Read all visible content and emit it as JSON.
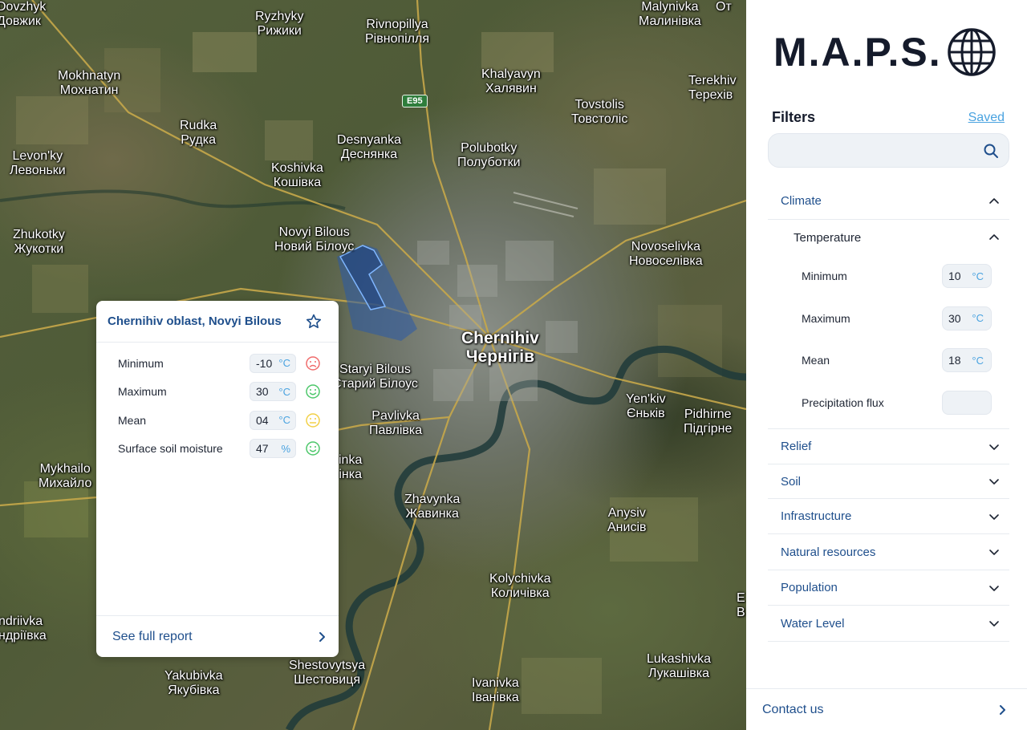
{
  "map": {
    "road_shield": "E95",
    "places": [
      {
        "id": "dovzhyk",
        "latin": "Dovzhyk",
        "cyr": "Довжик"
      },
      {
        "id": "ryzhyky",
        "latin": "Ryzhyky",
        "cyr": "Рижики"
      },
      {
        "id": "rivnopillya",
        "latin": "Rivnopillya",
        "cyr": "Рівнопілля"
      },
      {
        "id": "malynivka",
        "latin": "Malynivka",
        "cyr": "Малинівка"
      },
      {
        "id": "mokhnatyn",
        "latin": "Mokhnatyn",
        "cyr": "Мохнатин"
      },
      {
        "id": "khalyavyn",
        "latin": "Khalyavyn",
        "cyr": "Халявин"
      },
      {
        "id": "terekhivka",
        "latin": "Terekhiv",
        "cyr": "Терехів"
      },
      {
        "id": "tovstolis",
        "latin": "Tovstolis",
        "cyr": "Товстоліс"
      },
      {
        "id": "rudka",
        "latin": "Rudka",
        "cyr": "Рудка"
      },
      {
        "id": "desnyanka",
        "latin": "Desnyanka",
        "cyr": "Деснянка"
      },
      {
        "id": "polubotky",
        "latin": "Polubotky",
        "cyr": "Полуботки"
      },
      {
        "id": "levonky",
        "latin": "Levon'ky",
        "cyr": "Левоньки"
      },
      {
        "id": "koshivka",
        "latin": "Koshivka",
        "cyr": "Кошівка"
      },
      {
        "id": "zhukotky",
        "latin": "Zhukotky",
        "cyr": "Жукотки"
      },
      {
        "id": "novyi-bilous",
        "latin": "Novyi Bilous",
        "cyr": "Новий Білоус"
      },
      {
        "id": "novoselivka",
        "latin": "Novoselivka",
        "cyr": "Новоселівка"
      },
      {
        "id": "chernihiv",
        "latin": "Chernihiv",
        "cyr": "Чернігів"
      },
      {
        "id": "staryi-bilous",
        "latin": "Staryi Bilous",
        "cyr": "Старий Білоус"
      },
      {
        "id": "yenkiv",
        "latin": "Yen'kiv",
        "cyr": "Єньків"
      },
      {
        "id": "pidhirne",
        "latin": "Pidhirne",
        "cyr": "Підгірне"
      },
      {
        "id": "pavlivka",
        "latin": "Pavlivka",
        "cyr": "Павлівка"
      },
      {
        "id": "mykhailo",
        "latin": "Mykhailo",
        "cyr": "Михайло"
      },
      {
        "id": "inka",
        "latin": "inka",
        "cyr": "інка"
      },
      {
        "id": "zhavynka",
        "latin": "Zhavynka",
        "cyr": "Жавинка"
      },
      {
        "id": "anysiv",
        "latin": "Anysiv",
        "cyr": "Анисів"
      },
      {
        "id": "andriivka",
        "latin": "ndriivka",
        "cyr": "ндріївка"
      },
      {
        "id": "kolychivka",
        "latin": "Kolychivka",
        "cyr": "Количівка"
      },
      {
        "id": "yakubivka",
        "latin": "Yakubivka",
        "cyr": "Якубівка"
      },
      {
        "id": "shestovytsya",
        "latin": "Shestovytsya",
        "cyr": "Шестовиця"
      },
      {
        "id": "ivanivka",
        "latin": "Ivanivka",
        "cyr": "Іванівка"
      },
      {
        "id": "lukashivka",
        "latin": "Lukashivka",
        "cyr": "Лукашівка"
      },
      {
        "id": "ot",
        "latin": "",
        "cyr": "От"
      },
      {
        "id": "edge-e",
        "latin": "",
        "cyr": "Е"
      },
      {
        "id": "edge-b",
        "latin": "",
        "cyr": "В"
      }
    ]
  },
  "card": {
    "title": "Chernihiv oblast, Novyi Bilous",
    "rows": [
      {
        "label": "Minimum",
        "value": "-10",
        "unit": "°C",
        "mood": "sad",
        "mood_color": "#f06b6b"
      },
      {
        "label": "Maximum",
        "value": "30",
        "unit": "°C",
        "mood": "happy",
        "mood_color": "#4cc76a"
      },
      {
        "label": "Mean",
        "value": "04",
        "unit": "°C",
        "mood": "neutral",
        "mood_color": "#f2d046"
      },
      {
        "label": "Surface soil moisture",
        "value": "47",
        "unit": "%",
        "mood": "happy",
        "mood_color": "#4cc76a"
      }
    ],
    "footer_link": "See full report"
  },
  "sidebar": {
    "logo": "M.A.P.S.",
    "filters_title": "Filters",
    "saved_label": "Saved",
    "search": {
      "value": "",
      "placeholder": ""
    },
    "climate": {
      "label": "Climate",
      "temperature": {
        "label": "Temperature",
        "params": [
          {
            "label": "Minimum",
            "value": "10",
            "unit": "°C"
          },
          {
            "label": "Maximum",
            "value": "30",
            "unit": "°C"
          },
          {
            "label": "Mean",
            "value": "18",
            "unit": "°C"
          },
          {
            "label": "Precipitation flux",
            "value": "",
            "unit": ""
          }
        ]
      }
    },
    "sections": [
      {
        "label": "Relief"
      },
      {
        "label": "Soil"
      },
      {
        "label": "Infrastructure"
      },
      {
        "label": "Natural resources"
      },
      {
        "label": "Population"
      },
      {
        "label": "Water Level"
      }
    ],
    "contact_label": "Contact us"
  },
  "colors": {
    "accent_blue": "#1f4f8c",
    "link_blue": "#4aa3e0",
    "selection_fill": "#2a5aa8"
  }
}
